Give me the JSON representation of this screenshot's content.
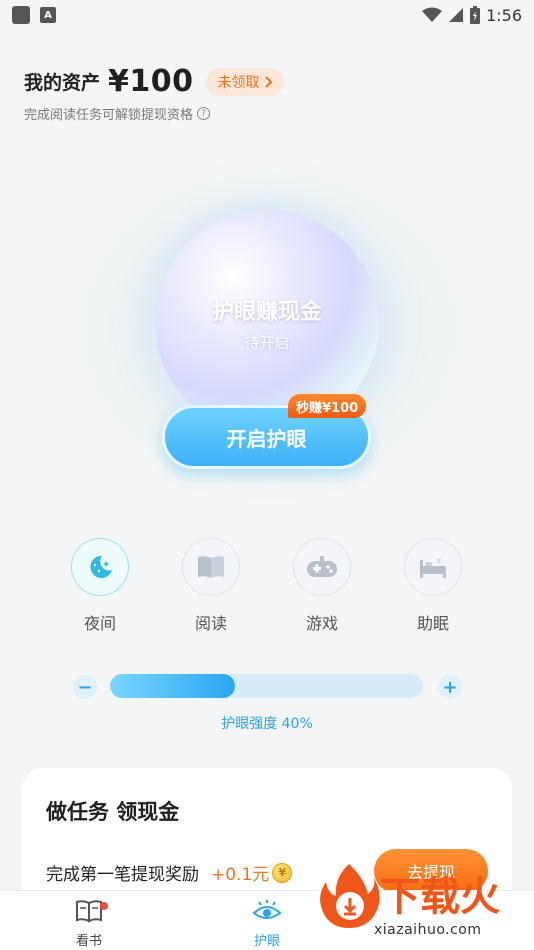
{
  "status_bar": {
    "time": "1:56",
    "notification_icon_letter": "A"
  },
  "assets": {
    "label": "我的资产",
    "amount": "¥100",
    "badge": "未领取",
    "subtitle": "完成阅读任务可解锁提现资格"
  },
  "orb": {
    "title": "护眼赚现金",
    "status": "待开启"
  },
  "enable_button": {
    "label": "开启护眼",
    "promo": "秒赚¥100"
  },
  "modes": [
    {
      "label": "夜间",
      "icon": "moon-stars-icon",
      "active": true
    },
    {
      "label": "阅读",
      "icon": "book-icon",
      "active": false
    },
    {
      "label": "游戏",
      "icon": "gamepad-icon",
      "active": false
    },
    {
      "label": "助眠",
      "icon": "bed-icon",
      "active": false
    }
  ],
  "intensity": {
    "value": 0.4,
    "label": "护眼强度 40%"
  },
  "tasks": {
    "title": "做任务 领现金",
    "items": [
      {
        "name": "完成第一笔提现奖励",
        "reward": "+0.1元",
        "button": "去提现"
      }
    ]
  },
  "bottom_nav": {
    "items": [
      {
        "label": "看书",
        "icon": "book-open-icon",
        "active": false,
        "dot": true
      },
      {
        "label": "护眼",
        "icon": "eye-icon",
        "active": true,
        "dot": false
      }
    ]
  },
  "watermark": {
    "text": "下载火",
    "url": "xiazaihuo.com"
  },
  "colors": {
    "accent": "#2aa4e8",
    "orange": "#f07820",
    "badge_bg": "#fde7d8"
  }
}
